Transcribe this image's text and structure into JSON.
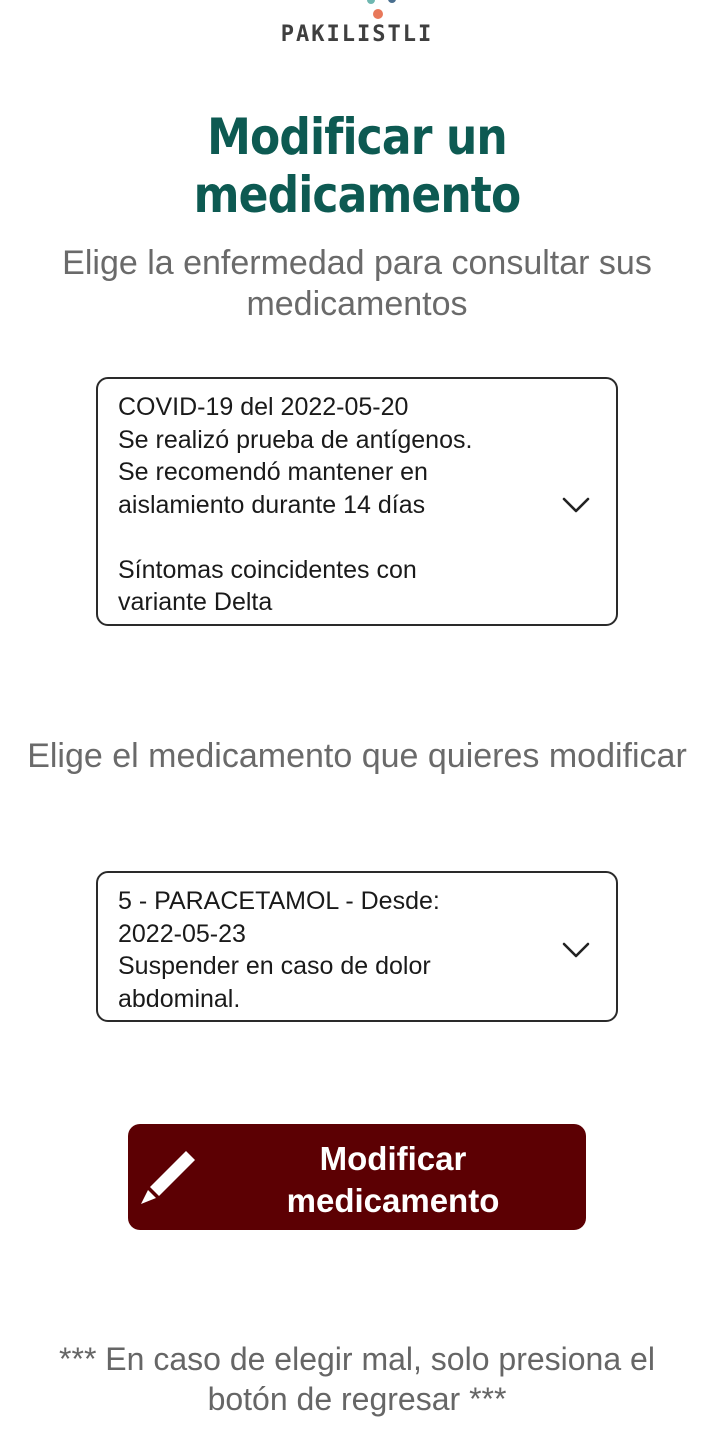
{
  "app": {
    "logo_text": "PAKILISTLI"
  },
  "page": {
    "title": "Modificar un medicamento"
  },
  "disease_section": {
    "prompt": "Elige la enfermedad para consultar sus medicamentos",
    "selected_lines": [
      "COVID-19 del 2022-05-20",
      "Se realizó prueba de antígenos.",
      "Se recomendó mantener en",
      "aislamiento durante 14 días",
      "",
      "Síntomas coincidentes con",
      "variante Delta"
    ]
  },
  "medication_section": {
    "prompt": "Elige el medicamento que quieres modificar",
    "selected_lines": [
      "5 - PARACETAMOL - Desde:",
      "2022-05-23",
      "Suspender en caso de dolor",
      "abdominal."
    ]
  },
  "action": {
    "label": "Modificar medicamento",
    "icon": "pencil-icon"
  },
  "footer": {
    "note": "*** En caso de elegir mal, solo presiona el botón de regresar ***"
  },
  "colors": {
    "title": "#0d5a52",
    "button_bg": "#5c0003",
    "button_text": "#ffffff",
    "prompt_text": "#6a6a6a",
    "logo_dot_blue": "#4a6f8f",
    "logo_dot_orange": "#e8785a",
    "logo_dot_teal": "#6fb7b0"
  }
}
